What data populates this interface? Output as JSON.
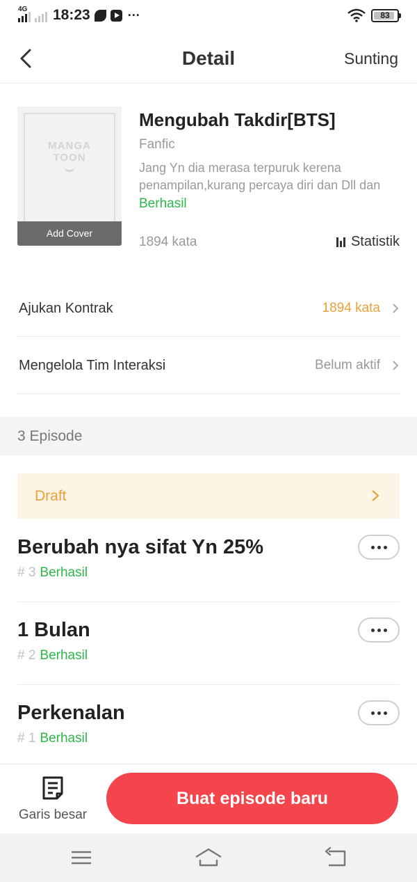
{
  "status_bar": {
    "network": "4G",
    "time": "18:23",
    "more": "···",
    "battery": "83"
  },
  "header": {
    "title": "Detail",
    "edit_label": "Sunting"
  },
  "story": {
    "cover_logo_line1": "MANGA",
    "cover_logo_line2": "TOON",
    "add_cover_label": "Add Cover",
    "title": "Mengubah Takdir[BTS]",
    "genre": "Fanfic",
    "description_line1": "Jang Yn dia merasa terpuruk kerena",
    "description_line2": "penampilan,kurang percaya diri dan Dll dan",
    "status": "Berhasil",
    "word_count": "1894 kata",
    "stats_label": "Statistik"
  },
  "rows": [
    {
      "label": "Ajukan Kontrak",
      "value": "1894 kata",
      "value_color": "#e6a23c"
    },
    {
      "label": "Mengelola Tim Interaksi",
      "value": "Belum aktif",
      "value_color": "#999999"
    }
  ],
  "episodes_section": {
    "count_label": "3 Episode",
    "draft_label": "Draft"
  },
  "episodes": [
    {
      "title": "Berubah nya sifat Yn 25%",
      "number": "# 3",
      "status": "Berhasil"
    },
    {
      "title": "1 Bulan",
      "number": "# 2",
      "status": "Berhasil"
    },
    {
      "title": "Perkenalan",
      "number": "# 1",
      "status": "Berhasil"
    }
  ],
  "bottom": {
    "outline_label": "Garis besar",
    "new_episode_label": "Buat episode baru"
  },
  "colors": {
    "accent": "#f5454c",
    "success": "#2cb84a",
    "warning": "#e6a23c",
    "draft_bg": "#fef4e6"
  }
}
